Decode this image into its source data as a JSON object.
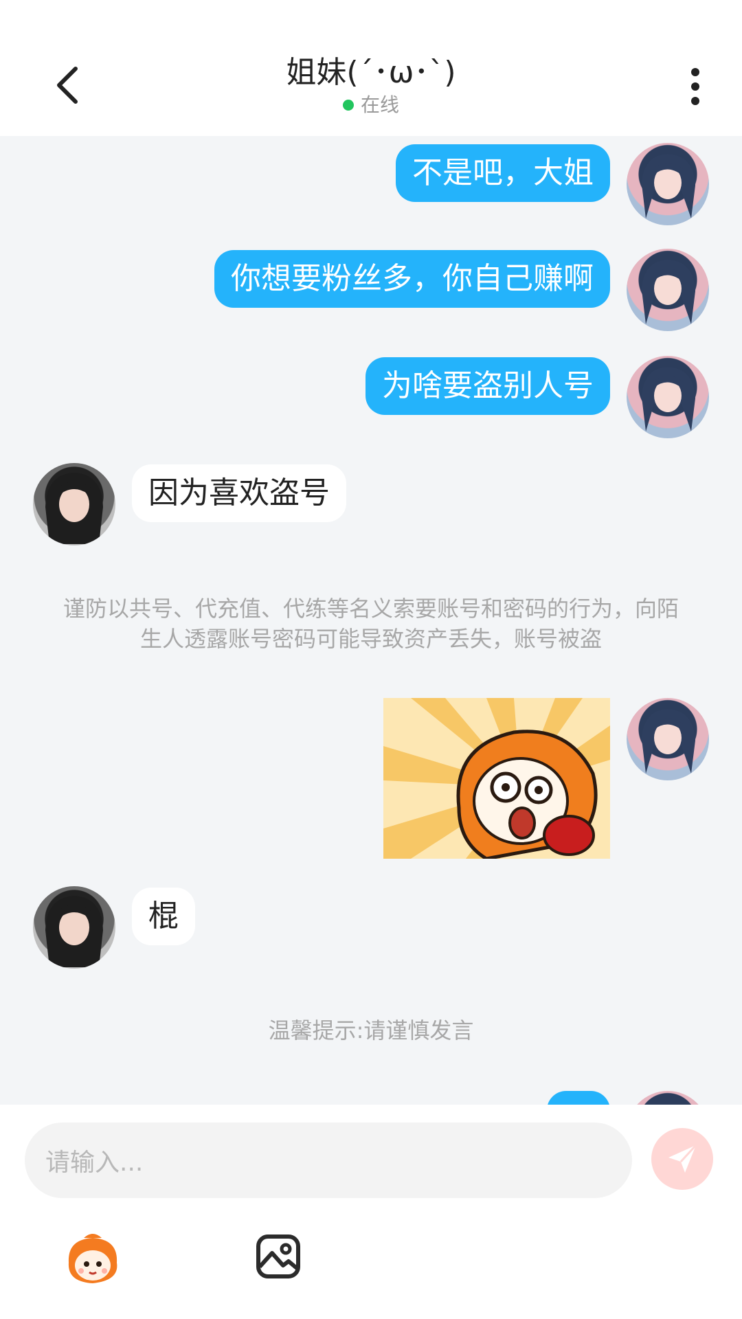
{
  "header": {
    "title": "姐妹(´･ω･`)",
    "status": "在线",
    "back_icon": "chevron-left-icon",
    "more_icon": "more-vertical-icon"
  },
  "messages": [
    {
      "from": "me",
      "text": "不是吧，大姐"
    },
    {
      "from": "me",
      "text": "你想要粉丝多，你自己赚啊"
    },
    {
      "from": "me",
      "text": "为啥要盗别人号"
    },
    {
      "from": "other",
      "text": "因为喜欢盗号"
    },
    {
      "type": "notice",
      "text": "谨防以共号、代充值、代练等名义索要账号和密码的行为，向陌生人透露账号密码可能导致资产丢失，账号被盗"
    },
    {
      "from": "me",
      "type": "sticker",
      "sticker": "shocked-character-sticker"
    },
    {
      "from": "other",
      "text": "棍"
    },
    {
      "type": "notice",
      "text": "温馨提示:请谨慎发言"
    }
  ],
  "composer": {
    "placeholder": "请输入...",
    "send_icon": "send-icon",
    "emoji_icon": "emoji-mascot-icon",
    "image_icon": "image-icon"
  },
  "colors": {
    "my_bubble": "#24b3fb",
    "other_bubble": "#ffffff",
    "chat_bg": "#f3f5f7",
    "online_dot": "#22c55e",
    "send_button": "#ffd7d5"
  }
}
